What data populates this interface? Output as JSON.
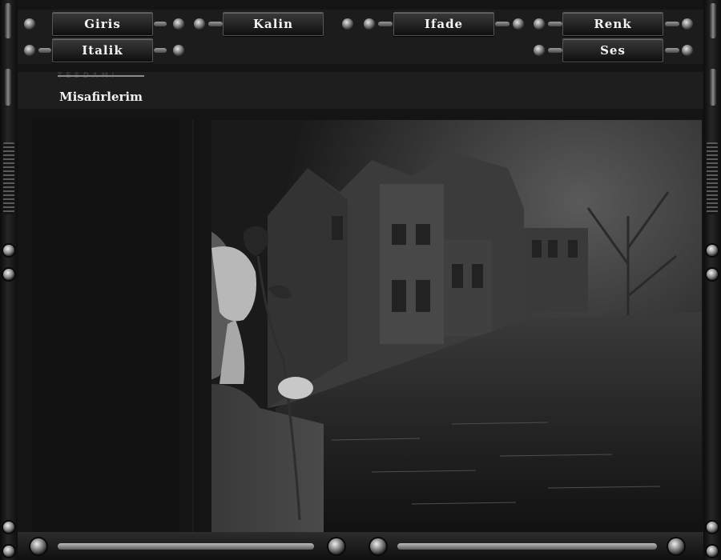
{
  "nav": {
    "row1": [
      "Giris",
      "Kalin",
      "Ifade",
      "Renk"
    ],
    "row2": [
      "Italik",
      "Ses"
    ]
  },
  "header": {
    "faded_text": "TESDAMI",
    "guests_label": "Misafirlerim"
  },
  "colors": {
    "frame": "#1c1c1c",
    "button_text": "#f4f4f4",
    "background": "#141414"
  },
  "icons": [
    "rivet-icon",
    "knob-icon",
    "grille-icon"
  ]
}
